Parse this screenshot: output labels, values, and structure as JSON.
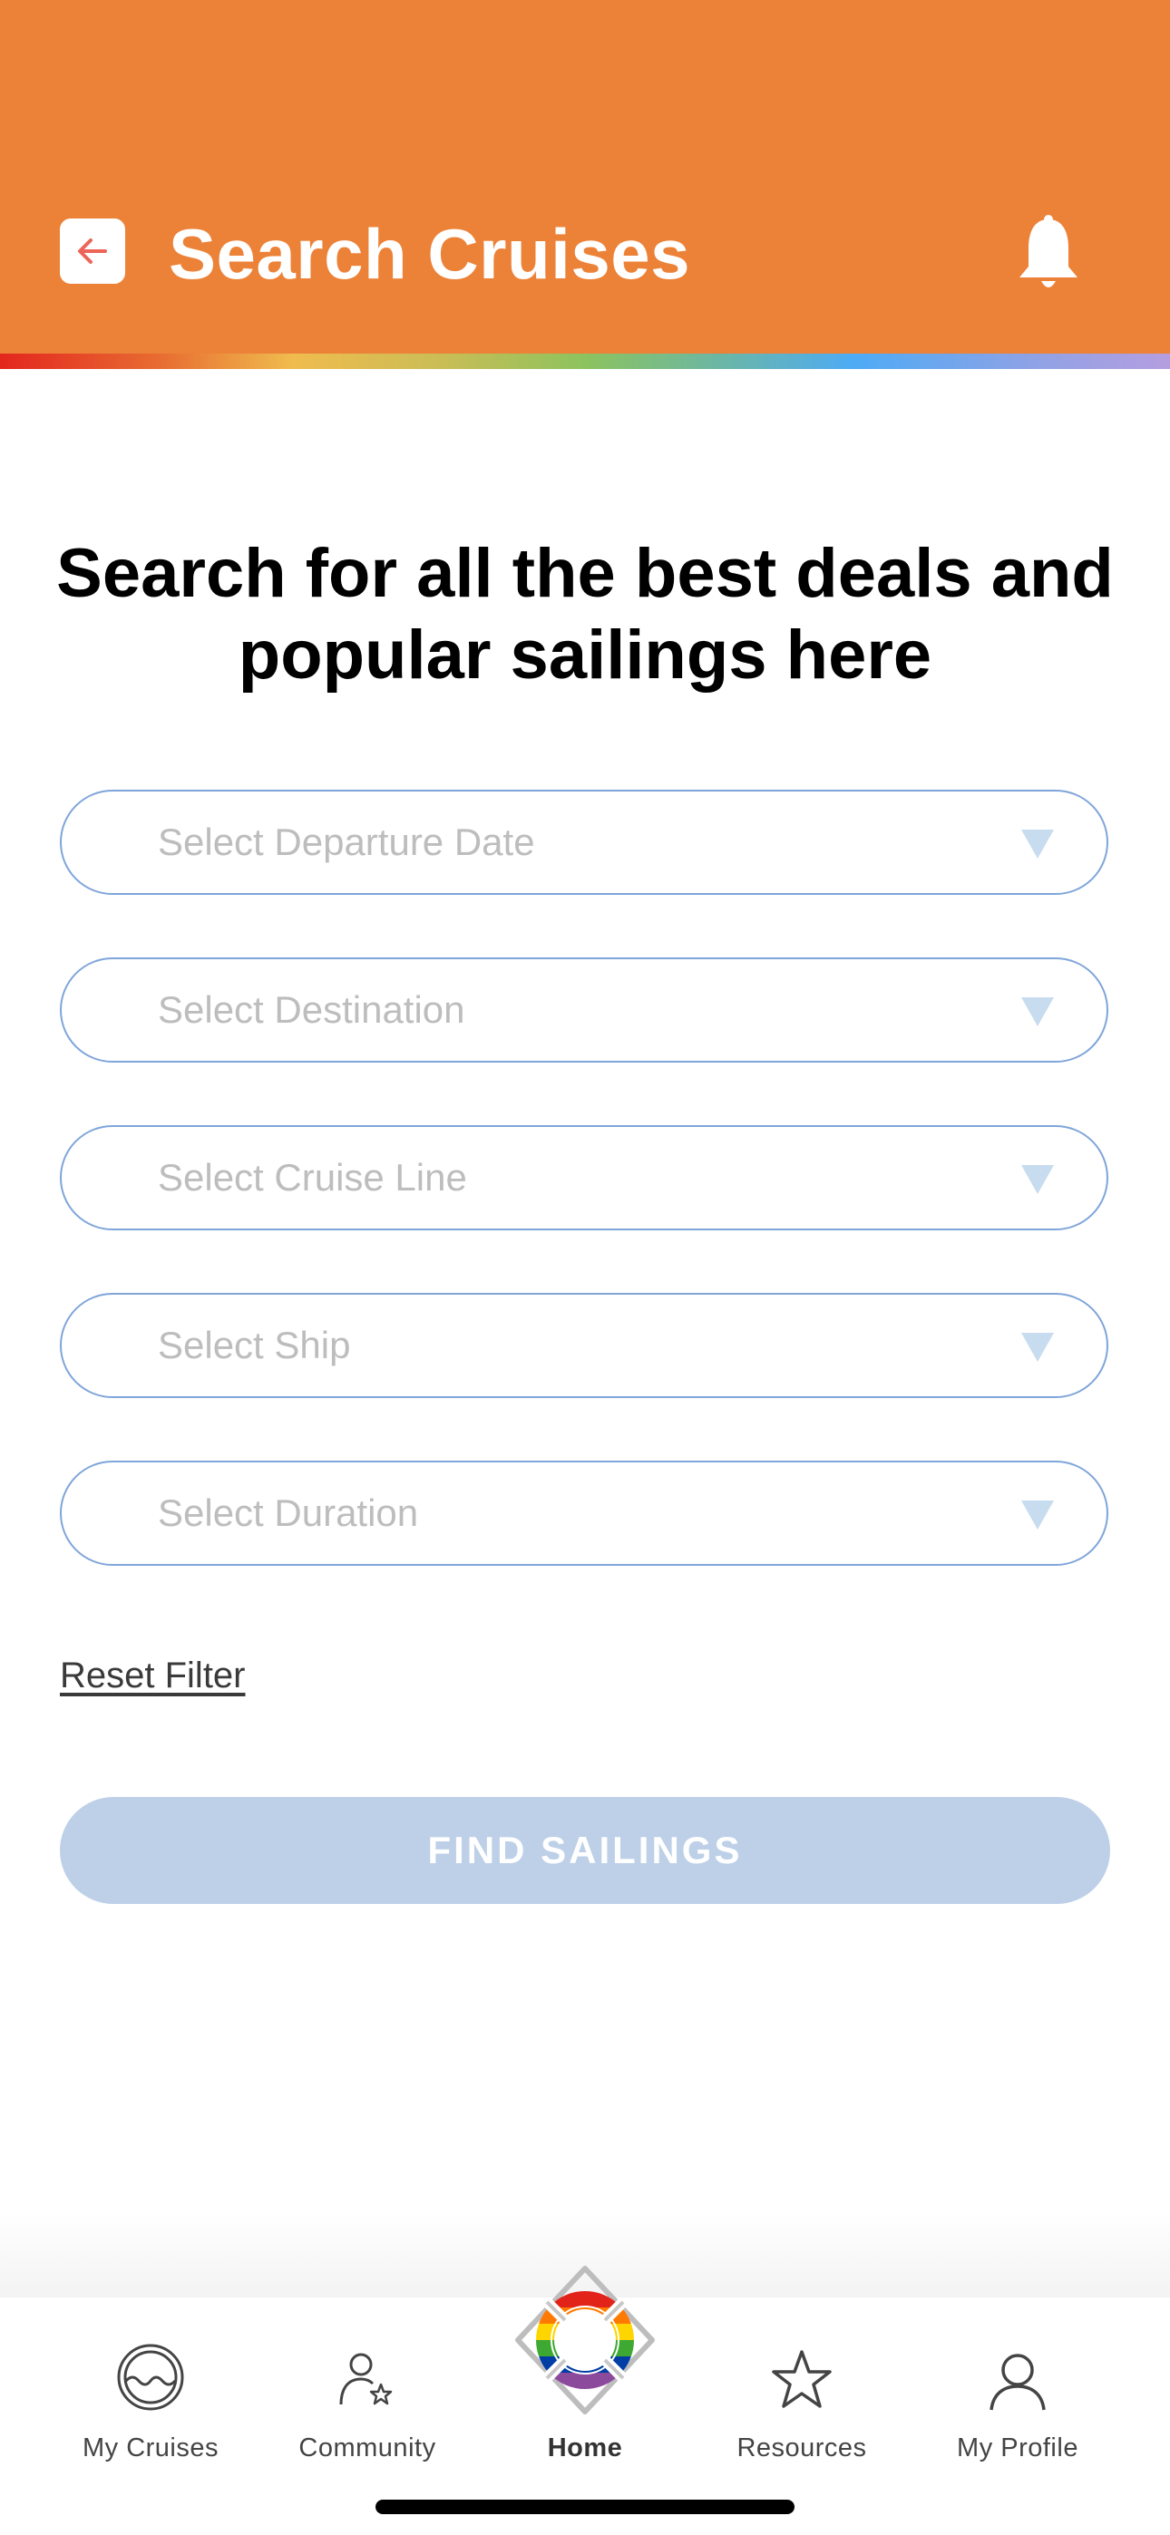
{
  "header": {
    "title": "Search Cruises",
    "back_icon": "arrow-left-icon",
    "notification_icon": "bell-icon",
    "background_color": "#EC8238"
  },
  "main": {
    "headline": "Search for all the best deals and popular sailings here",
    "fields": [
      {
        "placeholder": "Select Departure Date",
        "icon": "triangle-down-icon"
      },
      {
        "placeholder": "Select Destination",
        "icon": "triangle-down-icon"
      },
      {
        "placeholder": "Select Cruise Line",
        "icon": "triangle-down-icon"
      },
      {
        "placeholder": "Select Ship",
        "icon": "triangle-down-icon"
      },
      {
        "placeholder": "Select Duration",
        "icon": "triangle-down-icon"
      }
    ],
    "reset_label": "Reset Filter",
    "find_label": "FIND SAILINGS",
    "find_button_color": "#BDD0E8"
  },
  "tabbar": {
    "items": [
      {
        "label": "My Cruises",
        "icon": "porthole-icon",
        "active": false
      },
      {
        "label": "Community",
        "icon": "community-user-star-icon",
        "active": false
      },
      {
        "label": "Home",
        "icon": "rainbow-lifebuoy-icon",
        "active": true
      },
      {
        "label": "Resources",
        "icon": "star-icon",
        "active": false
      },
      {
        "label": "My Profile",
        "icon": "user-icon",
        "active": false
      }
    ]
  }
}
